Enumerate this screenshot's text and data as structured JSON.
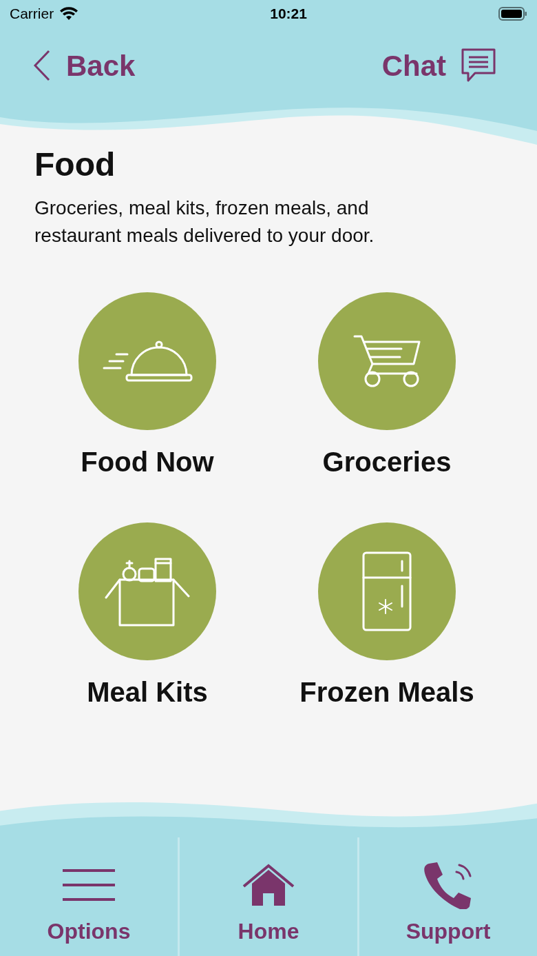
{
  "status_bar": {
    "carrier": "Carrier",
    "time": "10:21"
  },
  "nav": {
    "back": "Back",
    "chat": "Chat"
  },
  "page": {
    "title": "Food",
    "description": "Groceries, meal kits, frozen meals, and restaurant meals delivered to your door."
  },
  "categories": [
    {
      "label": "Food Now",
      "kind": "cloche"
    },
    {
      "label": "Groceries",
      "kind": "cart"
    },
    {
      "label": "Meal Kits",
      "kind": "box"
    },
    {
      "label": "Frozen Meals",
      "kind": "fridge"
    }
  ],
  "tab_bar": [
    {
      "label": "Options",
      "kind": "menu"
    },
    {
      "label": "Home",
      "kind": "home"
    },
    {
      "label": "Support",
      "kind": "phone"
    }
  ]
}
